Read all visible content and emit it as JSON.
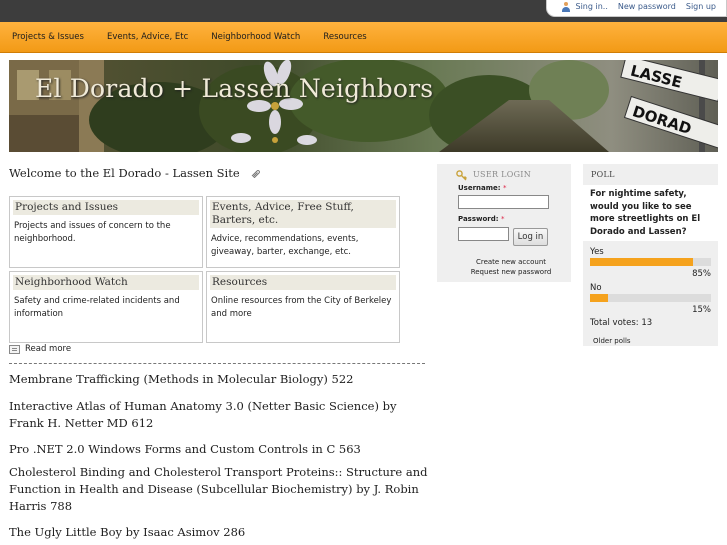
{
  "userbar": {
    "signin": "Sing in..",
    "new_password": "New password",
    "signup": "Sign up"
  },
  "nav": {
    "items": [
      "Projects & Issues",
      "Events, Advice, Etc",
      "Neighborhood Watch",
      "Resources"
    ]
  },
  "banner": {
    "title": "El Dorado + Lassen Neighbors"
  },
  "main": {
    "welcome": "Welcome to the El Dorado - Lassen Site",
    "cells": [
      {
        "title": "Projects and Issues",
        "body": "Projects and issues of concern to the neighborhood."
      },
      {
        "title": "Events, Advice, Free Stuff, Barters, etc.",
        "body": "Advice, recommendations, events, giveaway, barter, exchange, etc."
      },
      {
        "title": "Neighborhood Watch",
        "body": "Safety and crime-related incidents and information"
      },
      {
        "title": "Resources",
        "body": "Online resources from the City of Berkeley and more"
      }
    ],
    "read_more": "Read more",
    "books": [
      "Membrane Trafficking (Methods in Molecular Biology) 522",
      "Interactive Atlas of Human Anatomy 3.0 (Netter Basic Science) by Frank H. Netter MD 612",
      "Pro .NET 2.0 Windows Forms and Custom Controls in C 563",
      "Cholesterol Binding and Cholesterol Transport Proteins:: Structure and Function in Health and Disease (Subcellular Biochemistry) by J. Robin Harris 788",
      "The Ugly Little Boy by Isaac Asimov 286"
    ]
  },
  "login": {
    "title": "USER LOGIN",
    "username_label": "Username:",
    "password_label": "Password:",
    "required_mark": "*",
    "username_value": "",
    "password_value": "",
    "button": "Log in",
    "create_account": "Create new account",
    "request_password": "Request new password"
  },
  "poll": {
    "title": "POLL",
    "question": "For nightime safety, would you like to see more streetlights on El Dorado and Lassen?",
    "options": [
      {
        "label": "Yes",
        "percent": 85,
        "percent_text": "85%"
      },
      {
        "label": "No",
        "percent": 15,
        "percent_text": "15%"
      }
    ],
    "total_votes": "Total votes: 13",
    "older_polls": "Older polls"
  },
  "colors": {
    "nav_orange": "#f7a52a",
    "poll_bar": "#f5a21d",
    "top_strip": "#3d3d3d"
  }
}
